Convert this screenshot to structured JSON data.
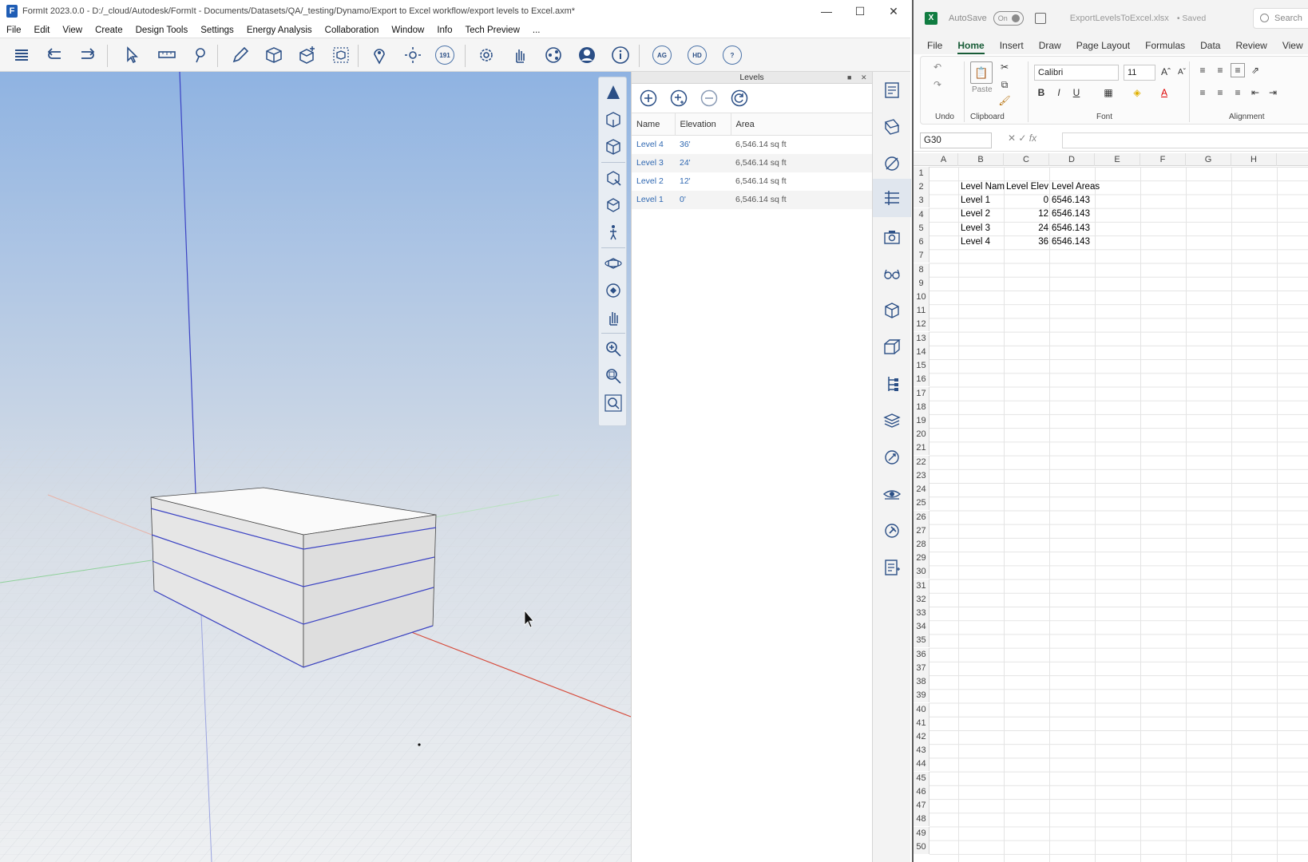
{
  "formit": {
    "title": "FormIt 2023.0.0 - D:/_cloud/Autodesk/FormIt - Documents/Datasets/QA/_testing/Dynamo/Export to Excel workflow/export levels to Excel.axm*",
    "menu": [
      "File",
      "Edit",
      "View",
      "Create",
      "Design Tools",
      "Settings",
      "Energy Analysis",
      "Collaboration",
      "Window",
      "Info",
      "Tech Preview",
      "..."
    ],
    "toolbar_badges": {
      "ag": "AG",
      "hd": "HD",
      "help": "?",
      "badge_191": "191"
    },
    "levels_panel": {
      "title": "Levels",
      "columns": [
        "Name",
        "Elevation",
        "Area"
      ],
      "rows": [
        {
          "name": "Level 4",
          "elevation": "36'",
          "area": "6,546.14 sq ft"
        },
        {
          "name": "Level 3",
          "elevation": "24'",
          "area": "6,546.14 sq ft"
        },
        {
          "name": "Level 2",
          "elevation": "12'",
          "area": "6,546.14 sq ft"
        },
        {
          "name": "Level 1",
          "elevation": "0'",
          "area": "6,546.14 sq ft"
        }
      ]
    }
  },
  "excel": {
    "autosave_label": "AutoSave",
    "autosave_state": "On",
    "filename": "ExportLevelsToExcel.xlsx",
    "saved_state": "• Saved",
    "search_placeholder": "Search",
    "tabs": [
      "File",
      "Home",
      "Insert",
      "Draw",
      "Page Layout",
      "Formulas",
      "Data",
      "Review",
      "View",
      "He"
    ],
    "ribbon": {
      "undo_label": "Undo",
      "clipboard_label": "Clipboard",
      "paste_label": "Paste",
      "font_label": "Font",
      "alignment_label": "Alignment",
      "font_name": "Calibri",
      "font_size": "11"
    },
    "name_box": "G30",
    "fx_label": "fx",
    "columns": [
      "A",
      "B",
      "C",
      "D",
      "E",
      "F",
      "G",
      "H"
    ],
    "row_count": 50,
    "cells": {
      "header": [
        "Level Nam",
        "Level Elev",
        "Level Areas"
      ],
      "rows": [
        {
          "name": "Level 1",
          "elev": "0",
          "area": "6546.143"
        },
        {
          "name": "Level 2",
          "elev": "12",
          "area": "6546.143"
        },
        {
          "name": "Level 3",
          "elev": "24",
          "area": "6546.143"
        },
        {
          "name": "Level 4",
          "elev": "36",
          "area": "6546.143"
        }
      ]
    }
  }
}
